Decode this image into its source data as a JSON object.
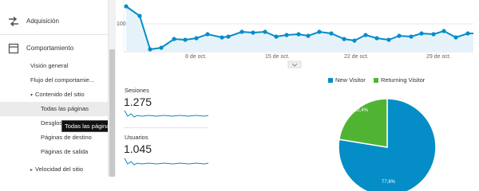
{
  "sidebar": {
    "sections": [
      {
        "label": "Adquisición",
        "icon": "acquisition-arrows-icon"
      },
      {
        "label": "Comportamiento",
        "icon": "behavior-page-icon"
      }
    ],
    "items": [
      {
        "label": "Visión general"
      },
      {
        "label": "Flujo del comportamie..."
      },
      {
        "label": "Contenido del sitio",
        "expanded": true
      },
      {
        "label": "Todas las páginas",
        "selected": true
      },
      {
        "label": "Desglos"
      },
      {
        "label": "Páginas de destino"
      },
      {
        "label": "Páginas de salida"
      },
      {
        "label": "Velocidad del sitio",
        "expanded": false
      }
    ],
    "tooltip": "Todas las páginas"
  },
  "overview_chart": {
    "y_tick": "100",
    "x_ticks": [
      "8 de oct.",
      "15 de oct.",
      "22 de oct.",
      "29 de oct."
    ],
    "color": "#058dc7",
    "fill": "#e6f2fa"
  },
  "metrics": [
    {
      "label": "Sesiones",
      "value": "1.275"
    },
    {
      "label": "Usuarios",
      "value": "1.045"
    }
  ],
  "pie": {
    "legend": [
      {
        "label": "New Visitor",
        "color": "#058dc7"
      },
      {
        "label": "Returning Visitor",
        "color": "#50b432"
      }
    ]
  },
  "chart_data": {
    "type": "pie",
    "categories": [
      "New Visitor",
      "Returning Visitor"
    ],
    "values": [
      77.6,
      22.4
    ],
    "labels": [
      "77,6%",
      "22,4%"
    ]
  }
}
